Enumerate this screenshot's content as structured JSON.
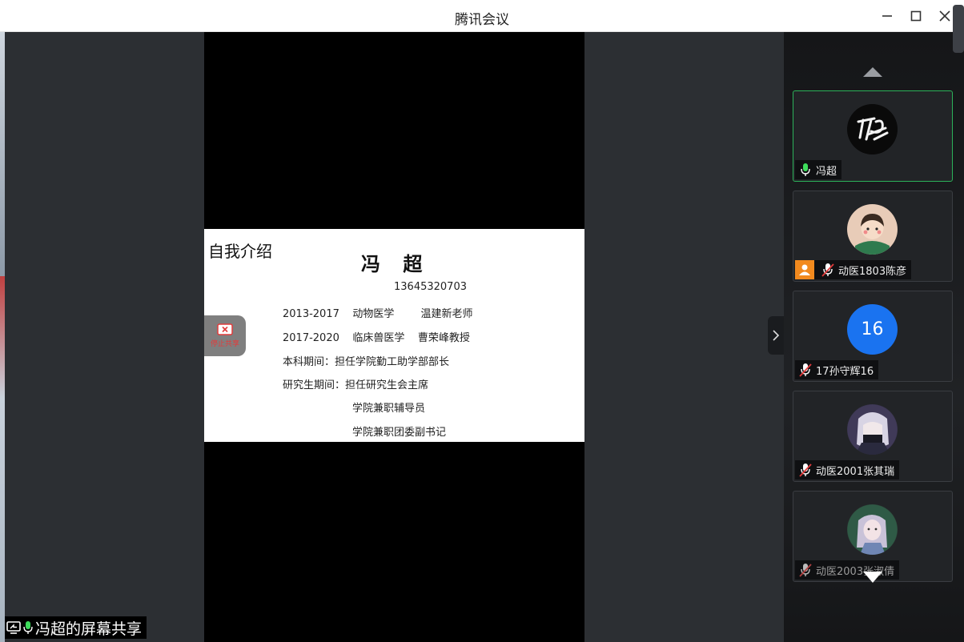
{
  "window": {
    "title": "腾讯会议"
  },
  "slide": {
    "heading": "自我介绍",
    "name": "冯 超",
    "phone": "13645320703",
    "lines": [
      "2013-2017    动物医学        温建新老师",
      "2017-2020    临床兽医学    曹荣峰教授",
      "本科期间：担任学院勤工助学部部长",
      "研究生期间：担任研究生会主席",
      "学院兼职辅导员",
      "学院兼职团委副书记"
    ],
    "stop_share_label": "停止共享"
  },
  "share_badge": {
    "label": "冯超的屏幕共享"
  },
  "participants": [
    {
      "name": "冯超",
      "avatar": "just-do-it-logo-avatar",
      "mic": "on",
      "active": true
    },
    {
      "name": "动医1803陈彦",
      "avatar": "cartoon-boy-avatar",
      "mic": "muted",
      "host": true
    },
    {
      "name": "17孙守辉16",
      "avatar_text": "16",
      "mic": "muted"
    },
    {
      "name": "动医2001张其瑞",
      "avatar": "anime-character-avatar",
      "mic": "muted"
    },
    {
      "name": "动医2003张淑倩",
      "avatar": "girl-photo-avatar",
      "mic": "muted"
    }
  ],
  "colors": {
    "active_border": "#2cb25a",
    "avatar_blue": "#1a73f0",
    "host_orange": "#f28a1e",
    "stop_red": "#e23b3b"
  }
}
